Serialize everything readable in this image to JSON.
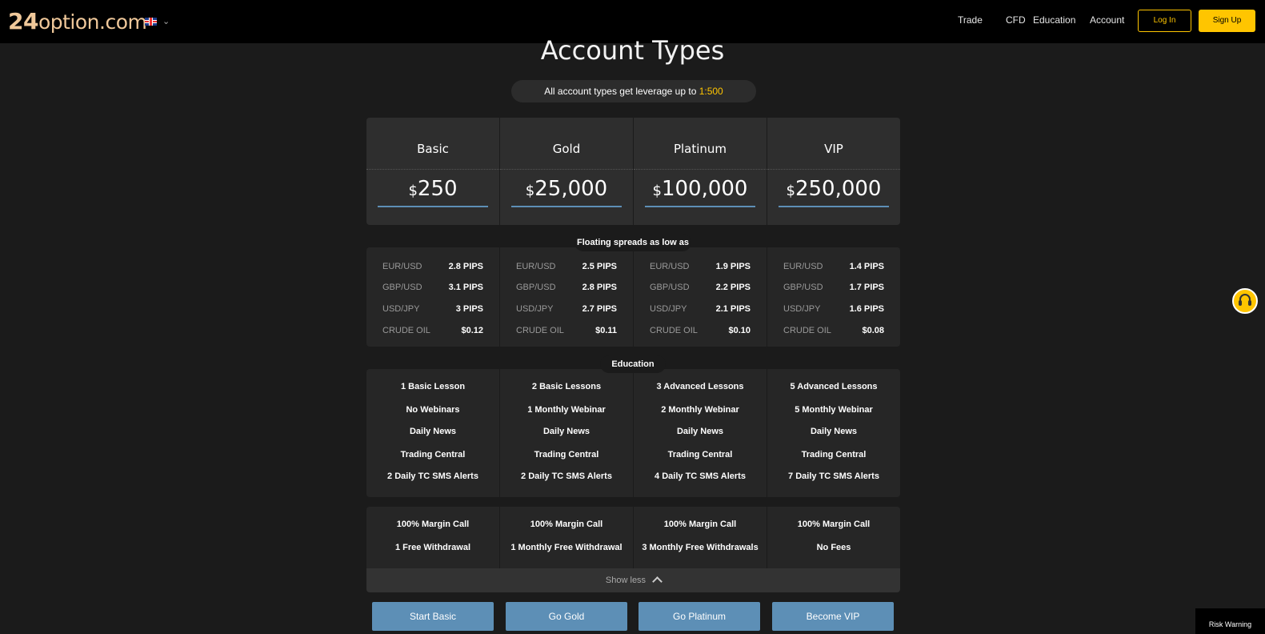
{
  "header": {
    "logo_num": "24",
    "logo_rest": "option.com",
    "nav": [
      "Trade",
      "CFD",
      "Education",
      "Account"
    ],
    "login_label": "Log In",
    "signup_label": "Sign Up"
  },
  "page": {
    "title": "Account Types",
    "leverage_text": "All account types get leverage up to ",
    "leverage_value": "1:500"
  },
  "tiers": [
    {
      "name": "Basic",
      "currency": "$",
      "amount": "250"
    },
    {
      "name": "Gold",
      "currency": "$",
      "amount": "25,000"
    },
    {
      "name": "Platinum",
      "currency": "$",
      "amount": "100,000"
    },
    {
      "name": "VIP",
      "currency": "$",
      "amount": "250,000"
    }
  ],
  "spreads": {
    "label": "Floating spreads as low as",
    "pairs": [
      "EUR/USD",
      "GBP/USD",
      "USD/JPY",
      "CRUDE OIL"
    ],
    "values": [
      [
        "2.8 PIPS",
        "3.1 PIPS",
        "3 PIPS",
        "$0.12"
      ],
      [
        "2.5 PIPS",
        "2.8 PIPS",
        "2.7 PIPS",
        "$0.11"
      ],
      [
        "1.9 PIPS",
        "2.2 PIPS",
        "2.1 PIPS",
        "$0.10"
      ],
      [
        "1.4 PIPS",
        "1.7 PIPS",
        "1.6 PIPS",
        "$0.08"
      ]
    ]
  },
  "education": {
    "label": "Education",
    "items": [
      [
        "1 Basic Lesson",
        "No Webinars",
        "Daily News",
        "Trading Central",
        "2 Daily TC SMS Alerts"
      ],
      [
        "2 Basic Lessons",
        "1 Monthly Webinar",
        "Daily News",
        "Trading Central",
        "2 Daily TC SMS Alerts"
      ],
      [
        "3 Advanced Lessons",
        "2 Monthly Webinar",
        "Daily News",
        "Trading Central",
        "4 Daily TC SMS Alerts"
      ],
      [
        "5 Advanced Lessons",
        "5 Monthly Webinar",
        "Daily News",
        "Trading Central",
        "7 Daily TC SMS Alerts"
      ]
    ]
  },
  "account": {
    "items": [
      [
        "100% Margin Call",
        "1 Free Withdrawal"
      ],
      [
        "100% Margin Call",
        "1 Monthly Free Withdrawal"
      ],
      [
        "100% Margin Call",
        "3 Monthly Free Withdrawals"
      ],
      [
        "100% Margin Call",
        "No Fees"
      ]
    ]
  },
  "show_less_label": "Show less",
  "cta": [
    "Start Basic",
    "Go Gold",
    "Go Platinum",
    "Become VIP"
  ],
  "risk_warning": "Risk Warning"
}
